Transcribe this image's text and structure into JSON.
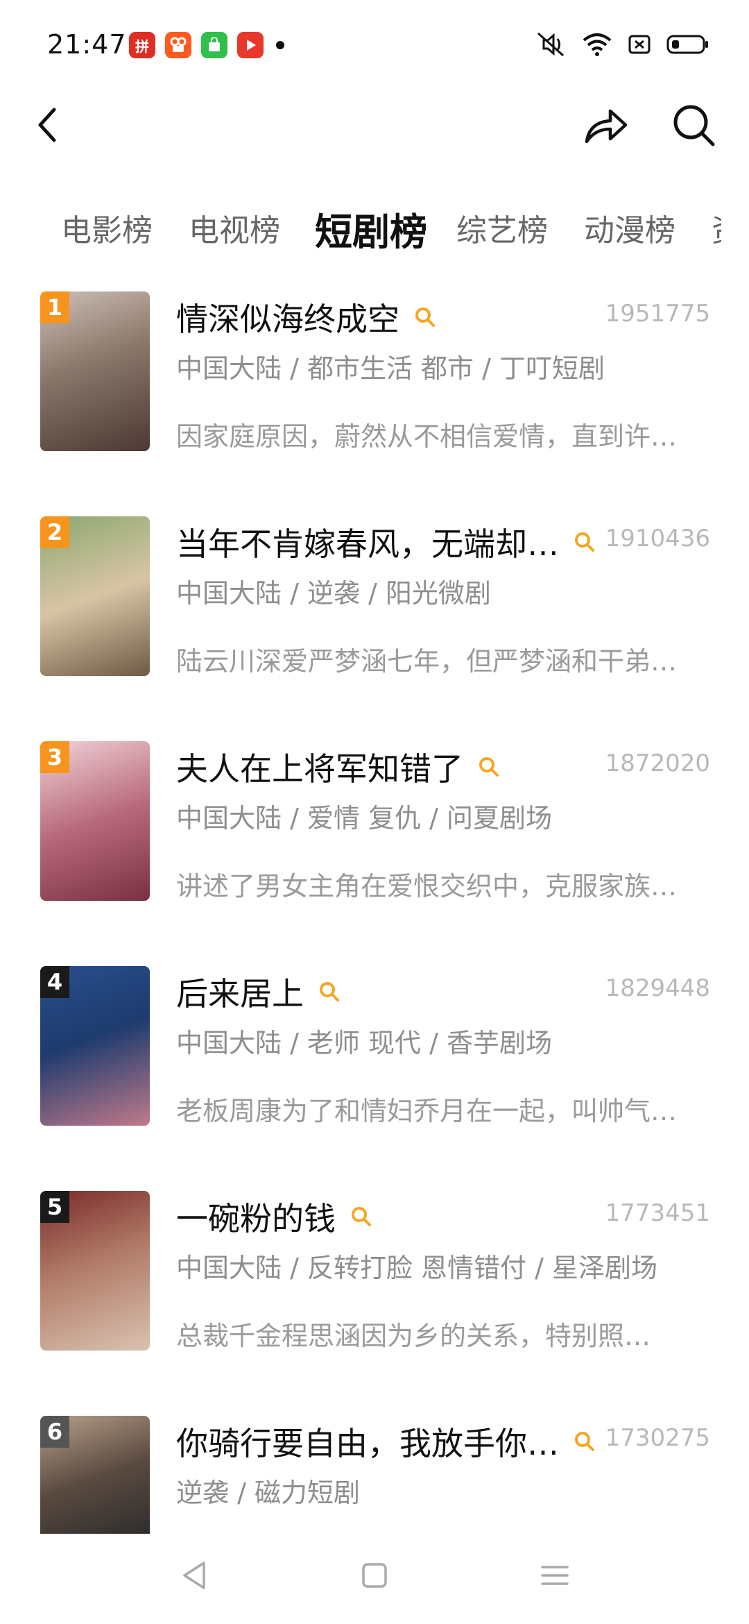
{
  "status_bar": {
    "time": "21:47",
    "app_icons": [
      {
        "name": "pinduoduo-icon",
        "color": "#e02e24"
      },
      {
        "name": "kuaishou-icon",
        "color": "#ff5a1f"
      },
      {
        "name": "app-market-icon",
        "color": "#2fbf4a"
      },
      {
        "name": "video-app-icon",
        "color": "#e8382b"
      }
    ],
    "system_icons": [
      "mute-icon",
      "wifi-icon",
      "sim-icon",
      "battery-icon"
    ]
  },
  "header": {
    "back_icon": "chevron-left-icon",
    "share_icon": "share-icon",
    "search_icon": "search-icon"
  },
  "tabs": [
    {
      "label": "电影榜",
      "active": false
    },
    {
      "label": "电视榜",
      "active": false
    },
    {
      "label": "短剧榜",
      "active": true
    },
    {
      "label": "综艺榜",
      "active": false
    },
    {
      "label": "动漫榜",
      "active": false
    },
    {
      "label": "资",
      "active": false
    }
  ],
  "items": [
    {
      "rank": "1",
      "title": "情深似海终成空",
      "score": "1951775",
      "meta": "中国大陆 / 都市生活 都市 / 丁叮短剧",
      "desc": "因家庭原因，蔚然从不相信爱情，直到许…",
      "badge_color": "#f7941d",
      "cover_colors": [
        "#6b5a52",
        "#cdbfb4"
      ]
    },
    {
      "rank": "2",
      "title": "当年不肯嫁春风，无端却…",
      "score": "1910436",
      "meta": "中国大陆 / 逆袭 / 阳光微剧",
      "desc": "陆云川深爱严梦涵七年，但严梦涵和干弟…",
      "badge_color": "#f7941d",
      "cover_colors": [
        "#6f8a4a",
        "#e8d6b8"
      ]
    },
    {
      "rank": "3",
      "title": "夫人在上将军知错了",
      "score": "1872020",
      "meta": "中国大陆 / 爱情 复仇 / 问夏剧场",
      "desc": "讲述了男女主角在爱恨交织中，克服家族…",
      "badge_color": "#f7941d",
      "cover_colors": [
        "#9a4a5c",
        "#f1d2d8"
      ]
    },
    {
      "rank": "4",
      "title": "后来居上",
      "score": "1829448",
      "meta": "中国大陆 / 老师 现代 / 香芋剧场",
      "desc": "老板周康为了和情妇乔月在一起，叫帅气…",
      "badge_color": "#1a1a1a",
      "cover_colors": [
        "#1d3b6e",
        "#c07a8a"
      ]
    },
    {
      "rank": "5",
      "title": "一碗粉的钱",
      "score": "1773451",
      "meta": "中国大陆 / 反转打脸 恩情错付 / 星泽剧场",
      "desc": "总裁千金程思涵因为乡的关系，特别照…",
      "badge_color": "#1a1a1a",
      "cover_colors": [
        "#7a2a2a",
        "#d9c2b0"
      ]
    },
    {
      "rank": "6",
      "title": "你骑行要自由，我放手你…",
      "score": "1730275",
      "meta": "逆袭 / 磁力短剧",
      "desc": "",
      "badge_color": "#555555",
      "cover_colors": [
        "#3b3b3b",
        "#b8a08a"
      ]
    }
  ],
  "nav_bar": {
    "back": "triangle-back-icon",
    "home": "square-home-icon",
    "menu": "menu-lines-icon"
  },
  "colors": {
    "accent": "#f5a623",
    "score": "#b8b8b8",
    "meta": "#8e8e8e"
  }
}
